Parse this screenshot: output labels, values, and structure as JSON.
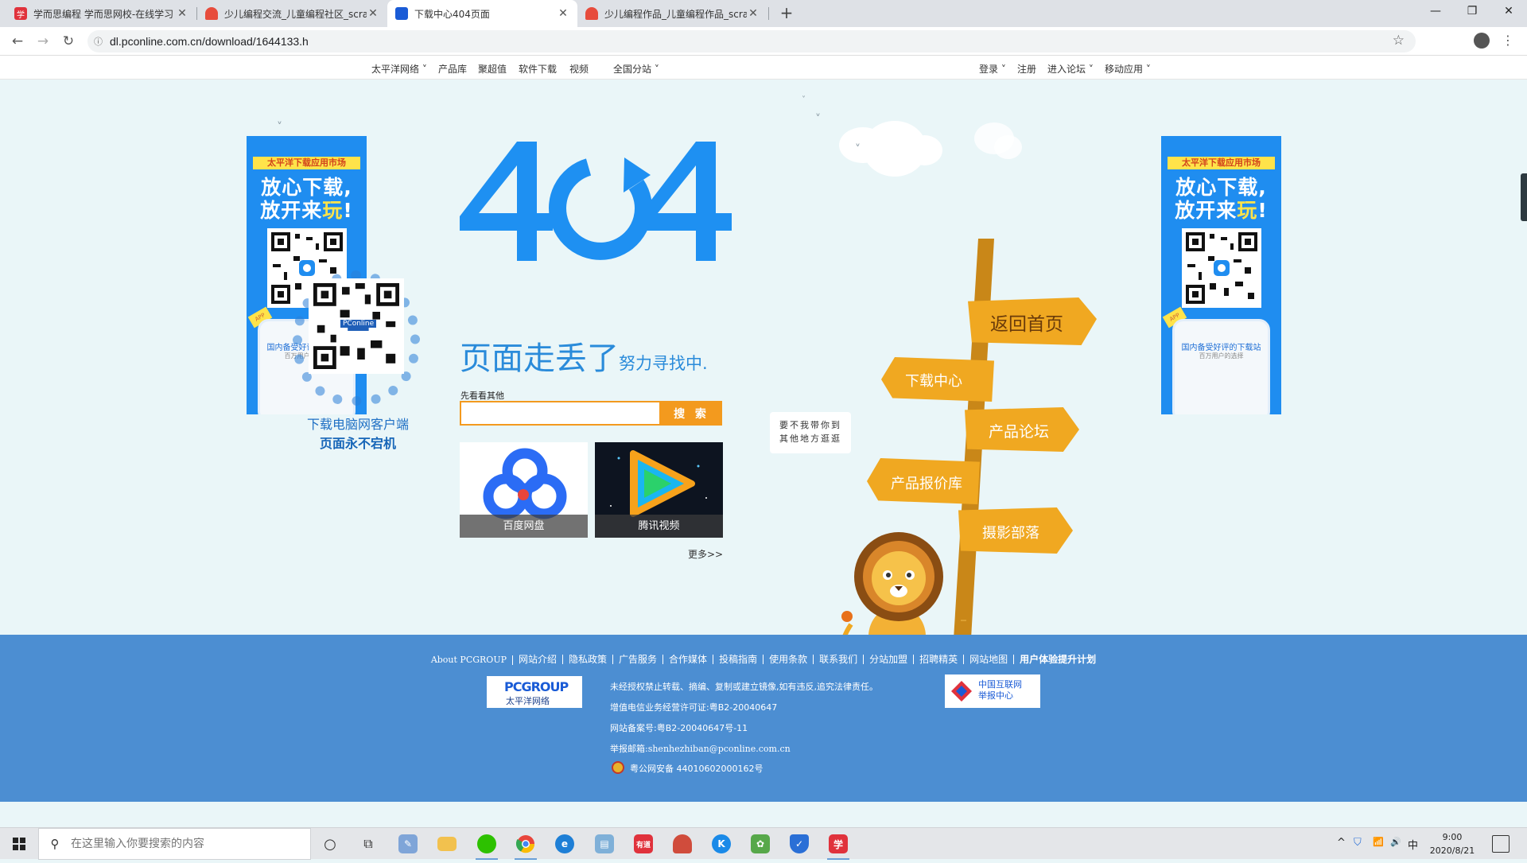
{
  "browser": {
    "tabs": [
      {
        "title": "学而思编程 学而思网校-在线学习",
        "favicon": "xueersi-icon",
        "color": "#e0323c",
        "glyph": "学",
        "active": false
      },
      {
        "title": "少儿编程交流_儿童编程社区_scratch",
        "favicon": "scratch-community-icon",
        "color": "#e74c3c",
        "glyph": "",
        "active": false
      },
      {
        "title": "下载中心404页面",
        "favicon": "pconline-icon",
        "color": "#1a5bd6",
        "glyph": "",
        "active": true
      },
      {
        "title": "少儿编程作品_儿童编程作品_scratch",
        "favicon": "scratch-community-icon",
        "color": "#e74c3c",
        "glyph": "",
        "active": false
      }
    ],
    "url": "dl.pconline.com.cn/download/1644133.h",
    "tab_close": "✕",
    "newtab": "+"
  },
  "topnav": {
    "left": [
      "太平洋网络",
      "产品库",
      "聚超值",
      "软件下载",
      "视频",
      "全国分站"
    ],
    "right": [
      "登录",
      "注册",
      "进入论坛",
      "移动应用"
    ]
  },
  "ad": {
    "top": "太平洋下载应用市场",
    "slogan1": "放心下载,",
    "slogan2a": "放开来",
    "slogan2b": "玩",
    "slogan2c": "!",
    "phone_text": "国内备受好评的下载站",
    "phone_sub": "百万用户的选择",
    "badge": "APP"
  },
  "client": {
    "line1": "下载电脑网客户端",
    "line2": "页面永不宕机",
    "qr_label": "PConline"
  },
  "error": {
    "code": "404",
    "title": "页面走丢了",
    "subtitle": "努力寻找中",
    "look_other": "先看看其他",
    "search_placeholder": "",
    "search_button": "搜 索",
    "more": "更多>>"
  },
  "apps": [
    {
      "name": "百度网盘",
      "icon": "baidu-netdisk-icon"
    },
    {
      "name": "腾讯视频",
      "icon": "tencent-video-icon"
    }
  ],
  "signs": {
    "speech": "要不我带你到其他地方逛逛",
    "items": [
      "返回首页",
      "下载中心",
      "产品论坛",
      "产品报价库",
      "摄影部落"
    ]
  },
  "footer": {
    "links": [
      "About PCGROUP",
      "网站介绍",
      "隐私政策",
      "广告服务",
      "合作媒体",
      "投稿指南",
      "使用条款",
      "联系我们",
      "分站加盟",
      "招聘精英",
      "网站地图",
      "用户体验提升计划"
    ],
    "logo_left": "PCGROUP",
    "logo_left_sub": "太平洋网络",
    "logo_right_line1": "中国互联网",
    "logo_right_line2": "举报中心",
    "info": [
      "未经授权禁止转载、摘编、复制或建立镜像,如有违反,追究法律责任。",
      "增值电信业务经营许可证:粤B2-20040647",
      "网站备案号:粤B2-20040647号-11",
      "举报邮箱:shenhezhiban@pconline.com.cn",
      "粤公网安备 44010602000162号"
    ]
  },
  "taskbar": {
    "search_placeholder": "在这里输入你要搜索的内容",
    "apps": [
      {
        "name": "cortana-icon",
        "color": "#333",
        "glyph": "○"
      },
      {
        "name": "task-view-icon",
        "color": "#333",
        "glyph": "⧉"
      },
      {
        "name": "paint-icon",
        "color": "#7fa5d8",
        "glyph": "✎"
      },
      {
        "name": "file-explorer-icon",
        "color": "#f2c14e",
        "glyph": "▬"
      },
      {
        "name": "wechat-icon",
        "color": "#2dc100",
        "glyph": "●"
      },
      {
        "name": "chrome-icon",
        "color": "#e8453c",
        "glyph": "◉"
      },
      {
        "name": "edge-icon",
        "color": "#1e7fd6",
        "glyph": "e"
      },
      {
        "name": "notepad-icon",
        "color": "#7fb0d8",
        "glyph": "▤"
      },
      {
        "name": "youdao-icon",
        "color": "#e0323c",
        "glyph": "有道"
      },
      {
        "name": "scratch-app-icon",
        "color": "#d04c3c",
        "glyph": "●"
      },
      {
        "name": "kugou-icon",
        "color": "#1a8ae8",
        "glyph": "K"
      },
      {
        "name": "scratch-editor-icon",
        "color": "#57a84a",
        "glyph": "✿"
      },
      {
        "name": "security-icon",
        "color": "#2a6fd6",
        "glyph": "✓"
      },
      {
        "name": "xueersi-app-icon",
        "color": "#e0323c",
        "glyph": "学"
      }
    ],
    "tray": [
      "^",
      "⛉",
      "📶",
      "🔊",
      "中"
    ],
    "time": "9:00",
    "date": "2020/8/21"
  }
}
